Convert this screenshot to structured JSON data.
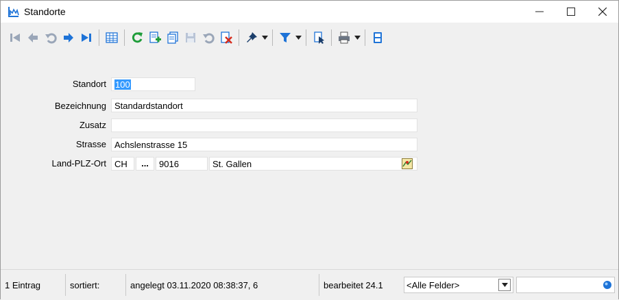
{
  "window": {
    "title": "Standorte",
    "minimize_icon": "minimize-icon",
    "maximize_icon": "maximize-icon",
    "close_icon": "close-icon"
  },
  "toolbar": {
    "buttons": [
      {
        "icon": "first-record-icon"
      },
      {
        "icon": "previous-record-icon"
      },
      {
        "icon": "undo-icon"
      },
      {
        "icon": "next-record-icon"
      },
      {
        "icon": "last-record-icon"
      },
      {
        "icon": "table-view-icon"
      },
      {
        "icon": "refresh-icon"
      },
      {
        "icon": "new-record-icon"
      },
      {
        "icon": "copy-record-icon"
      },
      {
        "icon": "save-icon"
      },
      {
        "icon": "revert-icon"
      },
      {
        "icon": "delete-record-icon"
      },
      {
        "icon": "pin-icon"
      },
      {
        "icon": "filter-icon"
      },
      {
        "icon": "document-pointer-icon"
      },
      {
        "icon": "print-icon"
      },
      {
        "icon": "exit-icon"
      }
    ],
    "colors": {
      "blue": "#1e73d7",
      "green": "#1f9d3a",
      "red": "#d42a1c",
      "gray": "#9aa6b8"
    }
  },
  "form": {
    "standort_label": "Standort",
    "standort_value": "100",
    "bezeichnung_label": "Bezeichnung",
    "bezeichnung_value": "Standardstandort",
    "zusatz_label": "Zusatz",
    "zusatz_value": "",
    "strasse_label": "Strasse",
    "strasse_value": "Achslenstrasse 15",
    "land_plz_ort_label": "Land-PLZ-Ort",
    "land_value": "CH",
    "land_button_label": "...",
    "plz_value": "9016",
    "ort_value": "St. Gallen",
    "map_icon": "map-icon"
  },
  "statusbar": {
    "count": "1 Eintrag",
    "sorted": "sortiert:",
    "created": "angelegt 03.11.2020 08:38:37, 6",
    "edited": "bearbeitet 24.1",
    "field_select": "<Alle Felder>",
    "search_value": ""
  }
}
